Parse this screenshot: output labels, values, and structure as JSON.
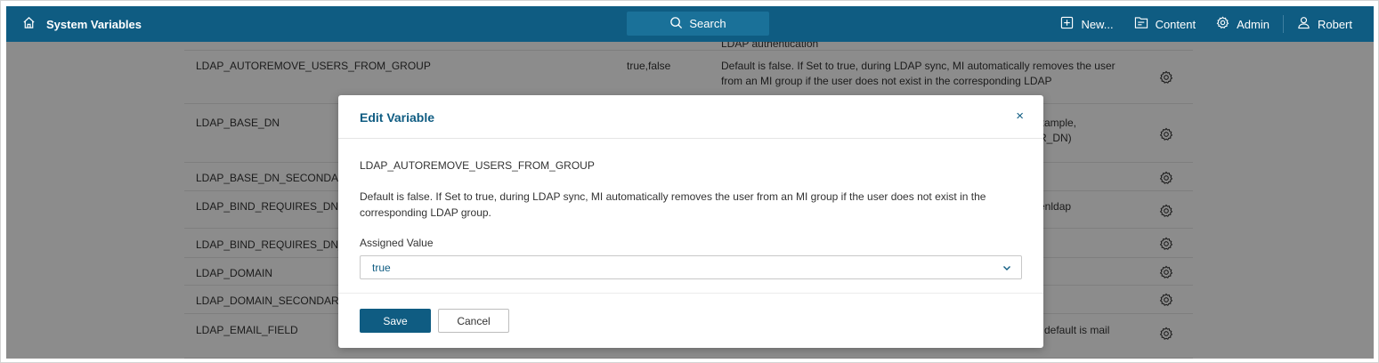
{
  "header": {
    "title": "System Variables",
    "search_label": "Search",
    "nav": {
      "new_label": "New...",
      "content_label": "Content",
      "admin_label": "Admin",
      "user_label": "Robert"
    }
  },
  "table": {
    "rows": [
      {
        "name": "",
        "values": "",
        "description": "LDAP authentication"
      },
      {
        "name": "LDAP_AUTOREMOVE_USERS_FROM_GROUP",
        "values": "true,false",
        "description": "Default is false. If Set to true, during LDAP sync, MI automatically removes the user from an MI group if the user does not exist in the corresponding LDAP"
      },
      {
        "name": "LDAP_BASE_DN",
        "values": "",
        "description": "xample,\nR_DN)"
      },
      {
        "name": "LDAP_BASE_DN_SECONDAR",
        "values": "",
        "description": ""
      },
      {
        "name": "LDAP_BIND_REQUIRES_DN",
        "values": "",
        "description": "enldap"
      },
      {
        "name": "LDAP_BIND_REQUIRES_DN_S",
        "values": "",
        "description": ""
      },
      {
        "name": "LDAP_DOMAIN",
        "values": "",
        "description": ""
      },
      {
        "name": "LDAP_DOMAIN_SECONDARY",
        "values": "",
        "description": ""
      },
      {
        "name": "LDAP_EMAIL_FIELD",
        "values": "",
        "description": "default is mail"
      }
    ]
  },
  "modal": {
    "title": "Edit Variable",
    "close_label": "×",
    "variable_name": "LDAP_AUTOREMOVE_USERS_FROM_GROUP",
    "description": "Default is false. If Set to true, during LDAP sync, MI automatically removes the user from an MI group if the user does not exist in the corresponding LDAP group.",
    "assigned_value_label": "Assigned Value",
    "assigned_value": "true",
    "save_label": "Save",
    "cancel_label": "Cancel"
  },
  "colors": {
    "brand": "#0f5c82",
    "overlay": "rgba(0,0,0,0.45)"
  }
}
